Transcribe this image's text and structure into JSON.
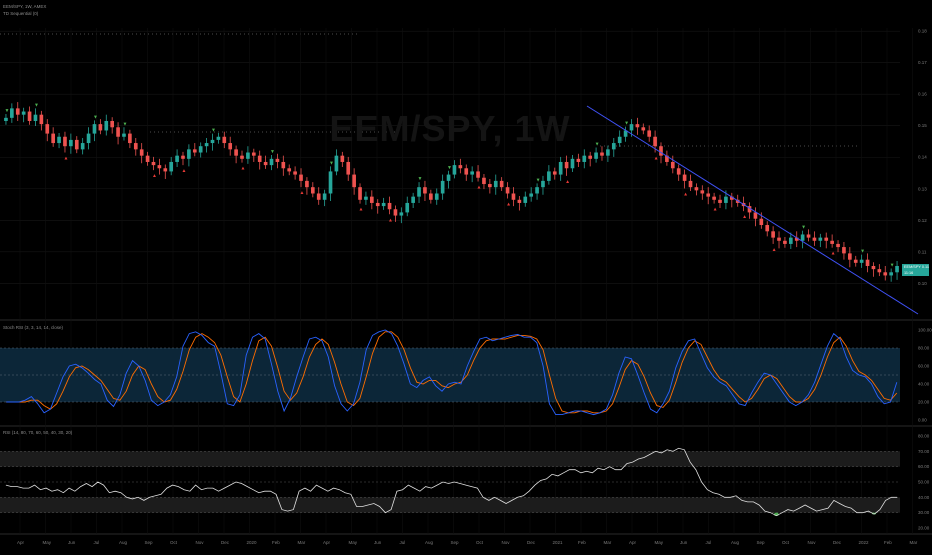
{
  "header": {
    "symbol_line": "EEM/SPY, 1W, AMEX",
    "indicator_line": "TD Sequential (0)",
    "stoch_label": "Stoch RSI (3, 3, 14, 14, close)",
    "rsi_label": "RSI (14, 80, 70, 60, 50, 40, 30, 20)",
    "watermark": "EEM/SPY, 1W"
  },
  "badge": {
    "symbol": "EEM/SPY",
    "value": "0.11",
    "sub": "11:16"
  },
  "colors": {
    "up": "#26a69a",
    "down": "#ef5350",
    "trend": "#3f51f5",
    "stoch_k": "#2962ff",
    "stoch_d": "#ff6d00",
    "rsi": "#e0e0e0",
    "band": "#0c2638",
    "rsi_fill": "#4caf50"
  },
  "chart_data": [
    {
      "type": "candlestick",
      "ylim": [
        0.089,
        0.181
      ],
      "y_ticks": [
        "0.18",
        "0.17",
        "0.16",
        "0.15",
        "0.14",
        "0.13",
        "0.12",
        "0.11",
        "0.10"
      ],
      "x_ticks": [
        "Apr",
        "May",
        "Jun",
        "Jul",
        "Aug",
        "Sep",
        "Oct",
        "Nov",
        "Dec",
        "2020",
        "Feb",
        "Mar",
        "Apr",
        "May",
        "Jun",
        "Jul",
        "Aug",
        "Sep",
        "Oct",
        "Nov",
        "Dec",
        "2021",
        "Feb",
        "Mar",
        "Apr",
        "May",
        "Jun",
        "Jul",
        "Aug",
        "Sep",
        "Oct",
        "Nov",
        "Dec",
        "2022",
        "Feb",
        "Mar"
      ],
      "close": [
        0.1525,
        0.1555,
        0.1535,
        0.1545,
        0.1515,
        0.1535,
        0.1505,
        0.1475,
        0.1445,
        0.1465,
        0.1435,
        0.1455,
        0.1425,
        0.1445,
        0.1475,
        0.1505,
        0.1485,
        0.1515,
        0.1495,
        0.1465,
        0.1475,
        0.1445,
        0.1425,
        0.1405,
        0.1385,
        0.1375,
        0.1365,
        0.1355,
        0.1385,
        0.1405,
        0.1395,
        0.1425,
        0.1415,
        0.1435,
        0.1445,
        0.1455,
        0.1465,
        0.1445,
        0.1425,
        0.1405,
        0.1395,
        0.1415,
        0.1405,
        0.1385,
        0.1375,
        0.1395,
        0.1385,
        0.1365,
        0.1355,
        0.1345,
        0.1325,
        0.1305,
        0.1285,
        0.1265,
        0.1285,
        0.1355,
        0.1405,
        0.1385,
        0.1345,
        0.1305,
        0.1265,
        0.1275,
        0.1255,
        0.1245,
        0.1255,
        0.1235,
        0.1215,
        0.1225,
        0.1255,
        0.1275,
        0.1305,
        0.1285,
        0.1265,
        0.1285,
        0.1325,
        0.1345,
        0.1375,
        0.1365,
        0.1345,
        0.1355,
        0.1335,
        0.1315,
        0.1305,
        0.1325,
        0.1305,
        0.1285,
        0.1265,
        0.1255,
        0.1275,
        0.1285,
        0.1305,
        0.1325,
        0.1355,
        0.1345,
        0.1385,
        0.1365,
        0.1395,
        0.1385,
        0.1405,
        0.1395,
        0.1415,
        0.1405,
        0.1425,
        0.1445,
        0.1465,
        0.1485,
        0.1505,
        0.1495,
        0.1485,
        0.1465,
        0.1435,
        0.1405,
        0.1385,
        0.1365,
        0.1345,
        0.1325,
        0.1305,
        0.1295,
        0.1285,
        0.1275,
        0.1265,
        0.1255,
        0.1275,
        0.1265,
        0.1255,
        0.1245,
        0.1225,
        0.1205,
        0.1185,
        0.1165,
        0.1145,
        0.1135,
        0.1125,
        0.1145,
        0.1135,
        0.1155,
        0.1145,
        0.1135,
        0.1145,
        0.1135,
        0.1125,
        0.1115,
        0.1095,
        0.1075,
        0.1065,
        0.1075,
        0.1055,
        0.1045,
        0.1035,
        0.1025,
        0.1035,
        0.1055
      ]
    },
    {
      "type": "line",
      "name": "Stoch RSI",
      "ylim": [
        0,
        100
      ],
      "y_ticks": [
        "100.00",
        "80.00",
        "60.00",
        "40.00",
        "20.00",
        "0.00"
      ],
      "band": [
        20,
        80
      ],
      "k": [
        20,
        20,
        20,
        22,
        26,
        18,
        8,
        12,
        30,
        48,
        60,
        62,
        58,
        52,
        45,
        40,
        22,
        15,
        28,
        52,
        66,
        60,
        44,
        22,
        16,
        20,
        28,
        48,
        82,
        96,
        98,
        94,
        86,
        82,
        52,
        18,
        16,
        28,
        72,
        92,
        96,
        90,
        62,
        32,
        10,
        24,
        48,
        70,
        90,
        92,
        88,
        70,
        38,
        18,
        10,
        18,
        42,
        78,
        94,
        98,
        100,
        96,
        82,
        62,
        40,
        36,
        44,
        48,
        38,
        32,
        40,
        42,
        40,
        60,
        76,
        90,
        92,
        88,
        90,
        92,
        94,
        95,
        92,
        92,
        86,
        60,
        18,
        6,
        6,
        8,
        10,
        10,
        8,
        6,
        8,
        12,
        28,
        52,
        70,
        68,
        50,
        30,
        12,
        8,
        18,
        32,
        58,
        76,
        88,
        90,
        74,
        58,
        48,
        42,
        38,
        28,
        18,
        16,
        30,
        42,
        52,
        50,
        40,
        30,
        20,
        16,
        20,
        28,
        42,
        62,
        82,
        96,
        90,
        70,
        55,
        50,
        48,
        40,
        26,
        18,
        20,
        42
      ],
      "d": [
        20,
        20,
        20,
        20,
        22,
        22,
        16,
        12,
        18,
        32,
        48,
        58,
        60,
        56,
        50,
        44,
        34,
        24,
        22,
        32,
        50,
        60,
        56,
        40,
        26,
        20,
        22,
        34,
        54,
        78,
        92,
        96,
        92,
        86,
        72,
        48,
        26,
        20,
        40,
        66,
        88,
        92,
        82,
        58,
        32,
        22,
        30,
        48,
        70,
        84,
        90,
        84,
        64,
        40,
        20,
        16,
        24,
        48,
        74,
        92,
        98,
        98,
        92,
        78,
        58,
        42,
        40,
        44,
        44,
        38,
        36,
        40,
        42,
        50,
        66,
        80,
        88,
        90,
        90,
        90,
        92,
        94,
        94,
        93,
        90,
        78,
        50,
        24,
        10,
        8,
        8,
        10,
        10,
        8,
        8,
        10,
        18,
        36,
        56,
        66,
        62,
        48,
        30,
        16,
        14,
        22,
        42,
        64,
        80,
        88,
        84,
        70,
        56,
        46,
        42,
        34,
        26,
        20,
        24,
        34,
        46,
        50,
        46,
        36,
        26,
        20,
        20,
        24,
        34,
        50,
        70,
        86,
        92,
        82,
        66,
        54,
        50,
        44,
        34,
        24,
        22,
        30
      ]
    },
    {
      "type": "line",
      "name": "RSI",
      "ylim": [
        20,
        80
      ],
      "y_ticks": [
        "80.00",
        "70.00",
        "60.00",
        "50.00",
        "40.00",
        "30.00",
        "20.00"
      ],
      "bands": [
        [
          60,
          70
        ],
        [
          30,
          40
        ]
      ],
      "values": [
        48,
        47,
        47,
        46,
        46,
        48,
        45,
        46,
        44,
        45,
        43,
        46,
        44,
        47,
        49,
        47,
        50,
        48,
        43,
        44,
        43,
        40,
        39,
        40,
        38,
        40,
        41,
        42,
        46,
        48,
        47,
        45,
        44,
        48,
        45,
        46,
        46,
        44,
        46,
        48,
        50,
        49,
        47,
        45,
        43,
        44,
        44,
        42,
        32,
        31,
        32,
        44,
        46,
        44,
        48,
        46,
        44,
        46,
        45,
        43,
        42,
        34,
        34,
        35,
        36,
        34,
        30,
        32,
        44,
        45,
        48,
        46,
        44,
        47,
        46,
        48,
        50,
        49,
        50,
        49,
        48,
        47,
        46,
        40,
        38,
        40,
        38,
        36,
        38,
        40,
        41,
        44,
        48,
        51,
        52,
        55,
        54,
        56,
        58,
        58,
        56,
        57,
        56,
        59,
        58,
        60,
        58,
        58,
        62,
        63,
        65,
        66,
        68,
        70,
        69,
        71,
        70,
        72,
        71,
        63,
        58,
        50,
        45,
        43,
        42,
        40,
        40,
        41,
        38,
        37,
        37,
        35,
        31,
        30,
        28,
        30,
        32,
        31,
        33,
        35,
        33,
        31,
        32,
        33,
        38,
        36,
        34,
        33,
        30,
        30,
        31,
        29,
        32,
        38,
        40,
        40
      ]
    }
  ]
}
